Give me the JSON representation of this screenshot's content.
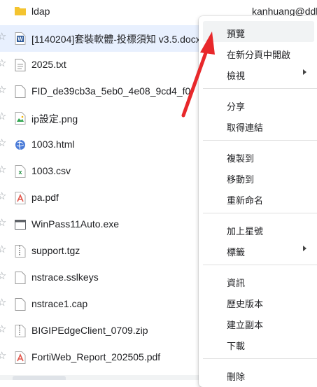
{
  "files": [
    {
      "name": "ldap",
      "owner": "kanhuang@ddb",
      "icon": "folder-icon",
      "selected": false,
      "star": false
    },
    {
      "name": "[1140204]套裝軟體-投標須知 v3.5.docx",
      "owner": "",
      "icon": "word-doc-icon",
      "selected": true,
      "star": true
    },
    {
      "name": "2025.txt",
      "owner": "",
      "icon": "text-file-icon",
      "selected": false,
      "star": true
    },
    {
      "name": "FID_de39cb3a_5eb0_4e08_9cd4_f0",
      "owner": "",
      "icon": "blank-file-icon",
      "selected": false,
      "star": true
    },
    {
      "name": "ip設定.png",
      "owner": "",
      "icon": "image-icon",
      "selected": false,
      "star": true
    },
    {
      "name": "1003.html",
      "owner": "",
      "icon": "html-icon",
      "selected": false,
      "star": true
    },
    {
      "name": "1003.csv",
      "owner": "",
      "icon": "spreadsheet-icon",
      "selected": false,
      "star": true
    },
    {
      "name": "pa.pdf",
      "owner": "",
      "icon": "pdf-icon",
      "selected": false,
      "star": true
    },
    {
      "name": "WinPass11Auto.exe",
      "owner": "",
      "icon": "exe-icon",
      "selected": false,
      "star": true
    },
    {
      "name": "support.tgz",
      "owner": "",
      "icon": "archive-icon",
      "selected": false,
      "star": true
    },
    {
      "name": "nstrace.sslkeys",
      "owner": "",
      "icon": "blank-file-icon",
      "selected": false,
      "star": true
    },
    {
      "name": "nstrace1.cap",
      "owner": "",
      "icon": "blank-file-icon",
      "selected": false,
      "star": true
    },
    {
      "name": "BIGIPEdgeClient_0709.zip",
      "owner": "",
      "icon": "archive-icon",
      "selected": false,
      "star": true
    },
    {
      "name": "FortiWeb_Report_202505.pdf",
      "owner": "",
      "icon": "pdf-icon",
      "selected": false,
      "star": true
    }
  ],
  "context_menu": {
    "items": [
      {
        "label": "預覽",
        "highlighted": true,
        "submenu": false
      },
      {
        "label": "在新分頁中開啟",
        "highlighted": false,
        "submenu": false
      },
      {
        "label": "檢視",
        "highlighted": false,
        "submenu": true
      },
      {
        "separator": true
      },
      {
        "label": "分享",
        "highlighted": false,
        "submenu": false
      },
      {
        "label": "取得連結",
        "highlighted": false,
        "submenu": false
      },
      {
        "separator": true
      },
      {
        "label": "複製到",
        "highlighted": false,
        "submenu": false
      },
      {
        "label": "移動到",
        "highlighted": false,
        "submenu": false
      },
      {
        "label": "重新命名",
        "highlighted": false,
        "submenu": false
      },
      {
        "separator": true
      },
      {
        "label": "加上星號",
        "highlighted": false,
        "submenu": false
      },
      {
        "label": "標籤",
        "highlighted": false,
        "submenu": true
      },
      {
        "separator": true
      },
      {
        "label": "資訊",
        "highlighted": false,
        "submenu": false
      },
      {
        "label": "歷史版本",
        "highlighted": false,
        "submenu": false
      },
      {
        "label": "建立副本",
        "highlighted": false,
        "submenu": false
      },
      {
        "label": "下載",
        "highlighted": false,
        "submenu": false
      },
      {
        "separator": true
      },
      {
        "label": "刪除",
        "highlighted": false,
        "submenu": false
      }
    ]
  },
  "colors": {
    "selected_row": "#e8f0fe",
    "folder": "#f4c430",
    "word": "#2b5797",
    "pdf": "#e2574c",
    "csv": "#1e8e3e",
    "html": "#4a7bd8",
    "image": "#34a853",
    "arrow": "#e8282b"
  }
}
